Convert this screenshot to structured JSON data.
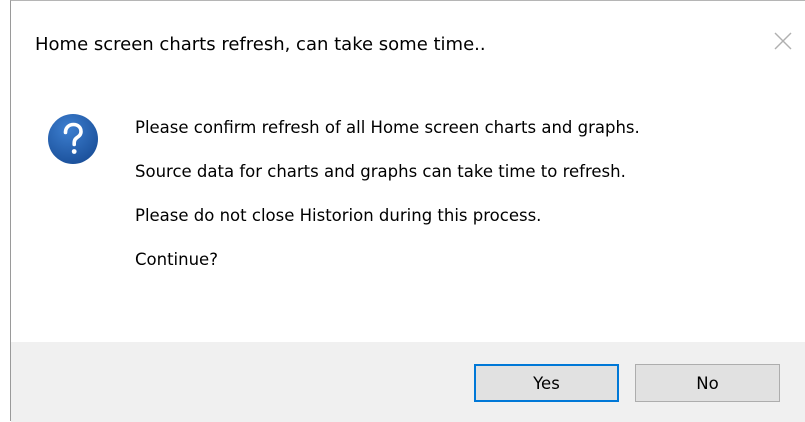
{
  "window": {
    "title": "Home screen charts refresh, can take some time.."
  },
  "message": {
    "icon": "question-icon",
    "lines": [
      "Please confirm refresh of all Home screen charts and graphs.",
      "Source data for charts and graphs can take time to refresh.",
      "Please do not close Historion during this process.",
      "Continue?"
    ]
  },
  "buttons": {
    "yes_label": "Yes",
    "no_label": "No"
  },
  "colors": {
    "icon_blue": "#1e5aa8",
    "default_button_border": "#0078d7",
    "footer_background": "#f0f0f0"
  }
}
